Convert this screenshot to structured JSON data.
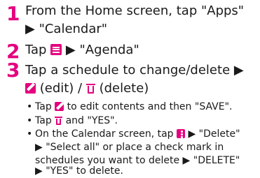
{
  "steps": [
    {
      "number": "1",
      "line1": "From the Home screen, tap \"Apps\"",
      "line2": "▶ \"Calendar\""
    },
    {
      "number": "2",
      "text_before": "Tap ",
      "icon": "menu-icon",
      "text_after": " ▶ \"Agenda\""
    },
    {
      "number": "3",
      "line1": "Tap a schedule to change/delete ▶",
      "edit_label": " (edit) / ",
      "delete_label": " (delete)"
    }
  ],
  "notes": {
    "bullet": "•",
    "note1_before": "Tap ",
    "note1_after": " to edit contents and then \"SAVE\".",
    "note2_before": "Tap ",
    "note2_after": " and \"YES\".",
    "note3_before": "On the Calendar screen, tap ",
    "note3_after": " ▶ \"Delete\"",
    "note3_line2": "▶ \"Select all\" or place a check mark in",
    "note3_line3": "schedules you want to delete ▶ \"DELETE\"",
    "note3_line4": "▶ \"YES\" to delete."
  },
  "icons": {
    "menu": "menu-icon",
    "edit": "edit-icon",
    "delete": "trash-icon",
    "more": "more-options-icon"
  },
  "colors": {
    "accent": "#e4007f",
    "text": "#1a1a1a"
  }
}
